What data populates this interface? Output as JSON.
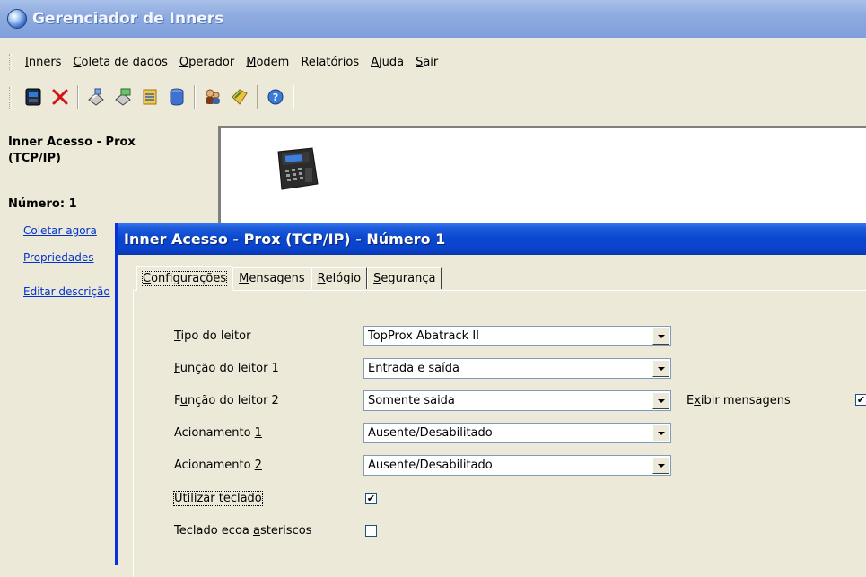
{
  "window": {
    "title": "Gerenciador de Inners"
  },
  "menu": [
    {
      "pre": "",
      "ul": "I",
      "post": "nners"
    },
    {
      "pre": "",
      "ul": "C",
      "post": "oleta de dados"
    },
    {
      "pre": "",
      "ul": "O",
      "post": "perador"
    },
    {
      "pre": "",
      "ul": "M",
      "post": "odem"
    },
    {
      "pre": "Relatórios",
      "ul": "",
      "post": ""
    },
    {
      "pre": "",
      "ul": "A",
      "post": "juda"
    },
    {
      "pre": "",
      "ul": "S",
      "post": "air"
    }
  ],
  "toolbar_icons": [
    "inner-device-icon",
    "delete-icon",
    "collect-icon",
    "collect-all-icon",
    "report-icon",
    "database-icon",
    "operators-icon",
    "tag-icon",
    "help-icon"
  ],
  "left_pane": {
    "inner_name": "Inner Acesso - Prox (TCP/IP)",
    "number": "Número: 1",
    "links": [
      "Coletar agora",
      "Propriedades",
      "Editar descrição"
    ]
  },
  "dialog": {
    "title": "Inner Acesso - Prox (TCP/IP) - Número 1",
    "tabs": [
      {
        "pre": "",
        "ul": "C",
        "post": "onfigurações"
      },
      {
        "pre": "",
        "ul": "M",
        "post": "ensagens"
      },
      {
        "pre": "",
        "ul": "R",
        "post": "elógio"
      },
      {
        "pre": "",
        "ul": "S",
        "post": "egurança"
      }
    ],
    "fields": {
      "tipo_leitor": {
        "label_ul": "T",
        "label_rest": "ipo do leitor",
        "value": "TopProx Abatrack II"
      },
      "funcao_leitor_1": {
        "label_ul": "F",
        "label_rest": "unção do leitor 1",
        "value": "Entrada e saída"
      },
      "funcao_leitor_2": {
        "label_pre": "F",
        "label_ul": "u",
        "label_rest": "nção do leitor 2",
        "value": "Somente saida"
      },
      "acionamento_1": {
        "label_pre": "Acionamento ",
        "label_ul": "1",
        "value": "Ausente/Desabilitado"
      },
      "acionamento_2": {
        "label_pre": "Acionamento ",
        "label_ul": "2",
        "value": "Ausente/Desabilitado"
      },
      "utilizar_teclado": {
        "label_pre": "Uti",
        "label_ul": "l",
        "label_rest": "izar teclado",
        "checked": true
      },
      "teclado_asteriscos": {
        "label_pre": "Teclado ecoa ",
        "label_ul": "a",
        "label_rest": "steriscos",
        "checked": false
      },
      "exibir_mensagens": {
        "label_pre": "E",
        "label_ul": "x",
        "label_rest": "ibir mensagens",
        "checked": true
      }
    },
    "check_glyph": "✔"
  }
}
